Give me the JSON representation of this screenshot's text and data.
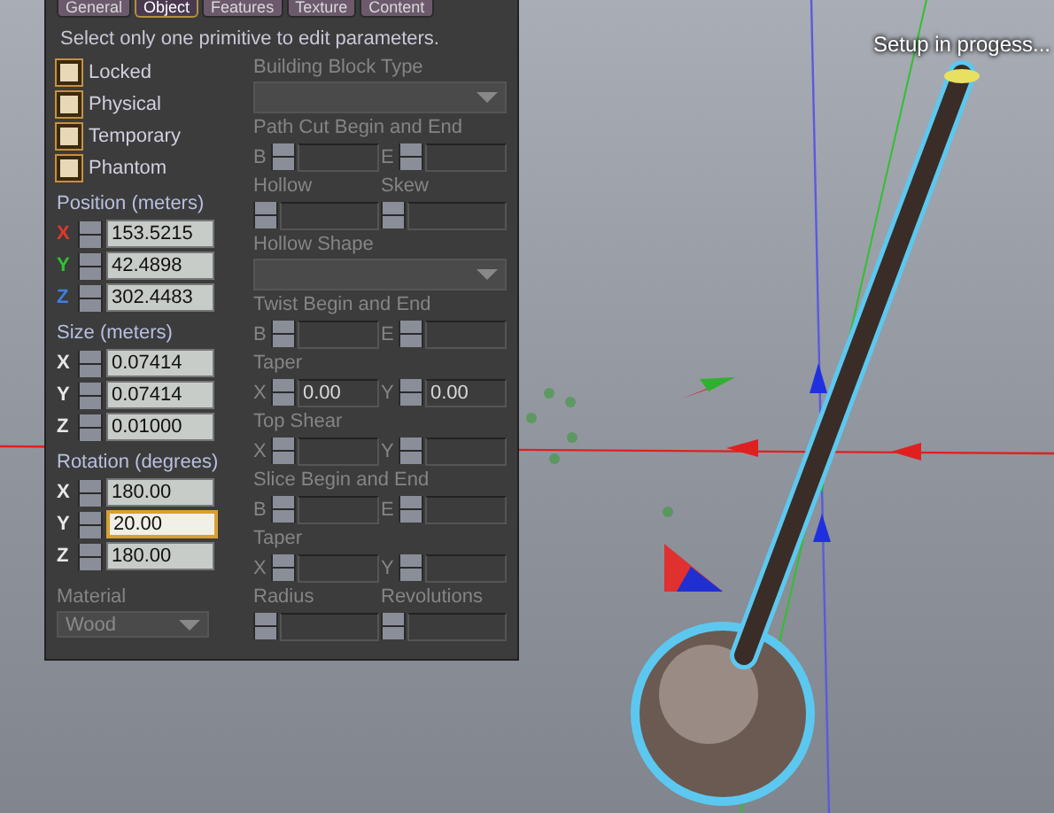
{
  "tabs": [
    {
      "label": "General",
      "selected": false
    },
    {
      "label": "Object",
      "selected": true
    },
    {
      "label": "Features",
      "selected": false
    },
    {
      "label": "Texture",
      "selected": false
    },
    {
      "label": "Content",
      "selected": false
    }
  ],
  "notice": "Select only one primitive to edit parameters.",
  "flags": [
    {
      "label": "Locked",
      "checked": false
    },
    {
      "label": "Physical",
      "checked": false
    },
    {
      "label": "Temporary",
      "checked": false
    },
    {
      "label": "Phantom",
      "checked": false
    }
  ],
  "vectors": [
    {
      "label": "Position (meters)",
      "fields": [
        {
          "axis": "X",
          "value": "153.5215",
          "color": "#e03a2a",
          "focused": false
        },
        {
          "axis": "Y",
          "value": "42.4898",
          "color": "#2fc42f",
          "focused": false
        },
        {
          "axis": "Z",
          "value": "302.4483",
          "color": "#3f7fe0",
          "focused": false
        }
      ]
    },
    {
      "label": "Size (meters)",
      "fields": [
        {
          "axis": "X",
          "value": "0.07414",
          "color": "#e8e8e8",
          "focused": false
        },
        {
          "axis": "Y",
          "value": "0.07414",
          "color": "#e8e8e8",
          "focused": false
        },
        {
          "axis": "Z",
          "value": "0.01000",
          "color": "#e8e8e8",
          "focused": false
        }
      ]
    },
    {
      "label": "Rotation (degrees)",
      "fields": [
        {
          "axis": "X",
          "value": "180.00",
          "color": "#e8e8e8",
          "focused": false
        },
        {
          "axis": "Y",
          "value": "20.00",
          "color": "#e8e8e8",
          "focused": true
        },
        {
          "axis": "Z",
          "value": "180.00",
          "color": "#e8e8e8",
          "focused": false
        }
      ]
    }
  ],
  "material": {
    "label": "Material",
    "value": "Wood",
    "disabled": true
  },
  "parameters": [
    {
      "kind": "dropdown",
      "label": "Building Block Type",
      "disabled": true
    },
    {
      "kind": "pair",
      "label": "Path Cut Begin and End",
      "disabled": true,
      "fields": [
        {
          "prefix": "B"
        },
        {
          "prefix": "E"
        }
      ]
    },
    {
      "kind": "split",
      "disabled": true,
      "fields": [
        {
          "label": "Hollow"
        },
        {
          "label": "Skew"
        }
      ]
    },
    {
      "kind": "dropdown",
      "label": "Hollow Shape",
      "disabled": true
    },
    {
      "kind": "pair",
      "label": "Twist Begin and End",
      "disabled": true,
      "fields": [
        {
          "prefix": "B"
        },
        {
          "prefix": "E"
        }
      ]
    },
    {
      "kind": "pair",
      "label": "Taper",
      "disabled": true,
      "fields": [
        {
          "prefix": "X",
          "value": "0.00"
        },
        {
          "prefix": "Y",
          "value": "0.00"
        }
      ]
    },
    {
      "kind": "pair",
      "label": "Top Shear",
      "disabled": true,
      "fields": [
        {
          "prefix": "X"
        },
        {
          "prefix": "Y"
        }
      ]
    },
    {
      "kind": "pair",
      "label": "Slice Begin and End",
      "disabled": true,
      "fields": [
        {
          "prefix": "B"
        },
        {
          "prefix": "E"
        }
      ]
    },
    {
      "kind": "pair",
      "label": "Taper",
      "disabled": true,
      "fields": [
        {
          "prefix": "X"
        },
        {
          "prefix": "Y"
        }
      ]
    },
    {
      "kind": "split",
      "disabled": true,
      "fields": [
        {
          "label": "Radius"
        },
        {
          "label": "Revolutions"
        }
      ]
    }
  ],
  "viewport": {
    "status": "Setup in progess..."
  }
}
